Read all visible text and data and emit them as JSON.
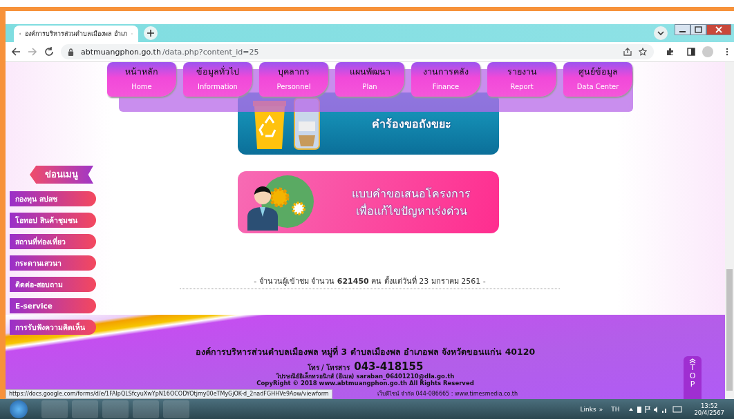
{
  "browser": {
    "tab_title": "องค์การบริหารส่วนตำบลเมืองพล อำเภ",
    "address_host": "abtmuangphon.go.th",
    "address_path": "/data.php?content_id=25"
  },
  "nav": [
    {
      "thai": "หน้าหลัก",
      "english": "Home"
    },
    {
      "thai": "ข้อมูลทั่วไป",
      "english": "Information"
    },
    {
      "thai": "บุคลากร",
      "english": "Personnel"
    },
    {
      "thai": "แผนพัฒนา",
      "english": "Plan"
    },
    {
      "thai": "งานการคลัง",
      "english": "Finance"
    },
    {
      "thai": "รายงาน",
      "english": "Report"
    },
    {
      "thai": "ศูนย์ข้อมูล",
      "english": "Data Center"
    }
  ],
  "side_menu": {
    "title": "ข่อนเมนู",
    "items": [
      "กองทุน สปสช",
      "โอทอป สินค้าชุมชน",
      "สถานที่ท่องเที่ยว",
      "กระดานเสวนา",
      "ติดต่อ-สอบถาม",
      "E-service",
      "การรับฟังความคิดเห็น"
    ]
  },
  "banners": [
    {
      "kind": "trash",
      "lines": [
        "คำร้องขอถังขยะ"
      ]
    },
    {
      "kind": "project",
      "lines": [
        "แบบคำขอเสนอโครงการ",
        "เพื่อแก้ไขปัญหาเร่งด่วน"
      ]
    }
  ],
  "visitor_counter": "- จำนวนผู้เข้าชม จำนวน **621450** คน ตั้งแต่วันที่ 23 มกราคม 2561 -",
  "footer": {
    "address": "องค์การบริหารส่วนตำบลเมืองพล หมู่ที่ 3 ตำบลเมืองพล อำเภอพล จังหวัดขอนแก่น 40120",
    "phone_label": "โทร / โทรสาร",
    "phone": "043-418155",
    "email": "ไปรษณีย์อิเล็กทรอนิกส์ (อีเมล) saraban_06401210@dla.go.th",
    "copyright": "CopyRight © 2018 www.abtmuangphon.go.th All Rights Reserved",
    "credit": "เว็บดีไซน์ จำกัด 044-086665 : www.timesmedia.co.th"
  },
  "top_button": "TOP",
  "status_link": "https://docs.google.com/forms/d/e/1FAIpQLSfcyuXwYpN16OCODYOtjmy00eTMyGjOK-d_2nadFGHHVe9Aow/viewform",
  "taskbar": {
    "links": "Links",
    "overflow": "»",
    "language": "TH",
    "time": "13:52",
    "date": "20/4/2567"
  }
}
